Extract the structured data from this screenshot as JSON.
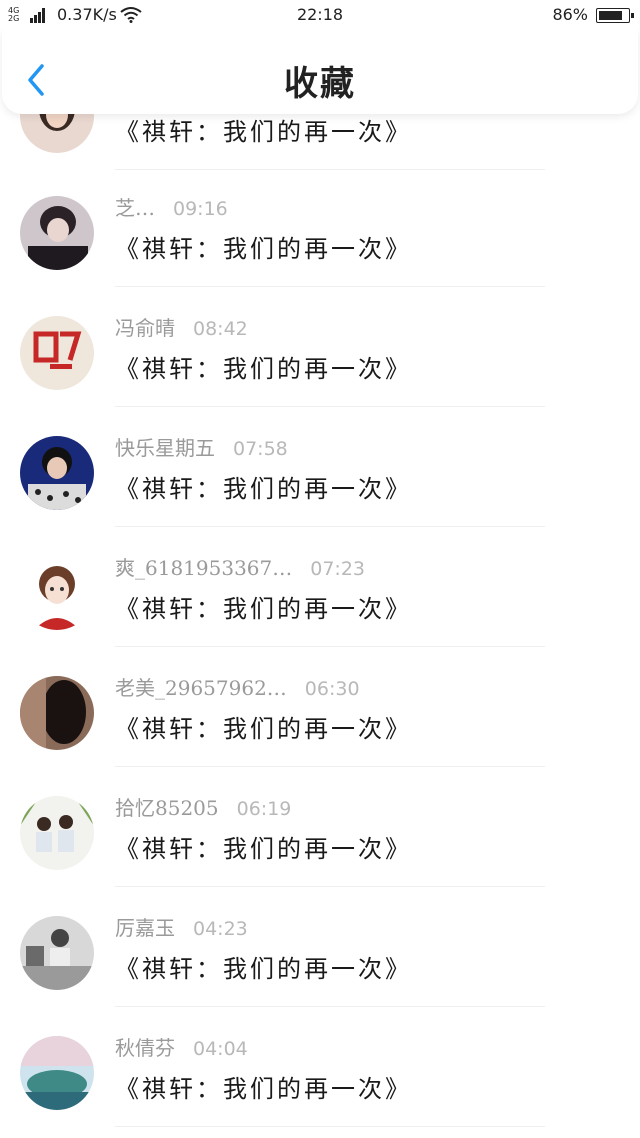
{
  "status_bar": {
    "network": "4G 2G",
    "speed": "0.37K/s",
    "time": "22:18",
    "battery": "86%",
    "battery_level": 0.86
  },
  "header": {
    "title": "收藏",
    "back_icon": "chevron-left-icon",
    "accent": "#2196f3"
  },
  "message_text": "《祺轩：我们的再一次》",
  "items": [
    {
      "name": "",
      "time": "",
      "message": "《祺轩：我们的再一次》"
    },
    {
      "name": "芝…",
      "time": "09:16",
      "message": "《祺轩：我们的再一次》"
    },
    {
      "name": "冯俞晴",
      "time": "08:42",
      "message": "《祺轩：我们的再一次》"
    },
    {
      "name": "快乐星期五",
      "time": "07:58",
      "message": "《祺轩：我们的再一次》"
    },
    {
      "name": "爽_6181953367…",
      "time": "07:23",
      "message": "《祺轩：我们的再一次》"
    },
    {
      "name": "老美_29657962…",
      "time": "06:30",
      "message": "《祺轩：我们的再一次》"
    },
    {
      "name": "拾忆85205",
      "time": "06:19",
      "message": "《祺轩：我们的再一次》"
    },
    {
      "name": "厉嘉玉",
      "time": "04:23",
      "message": "《祺轩：我们的再一次》"
    },
    {
      "name": "秋倩芬",
      "time": "04:04",
      "message": "《祺轩：我们的再一次》"
    }
  ]
}
